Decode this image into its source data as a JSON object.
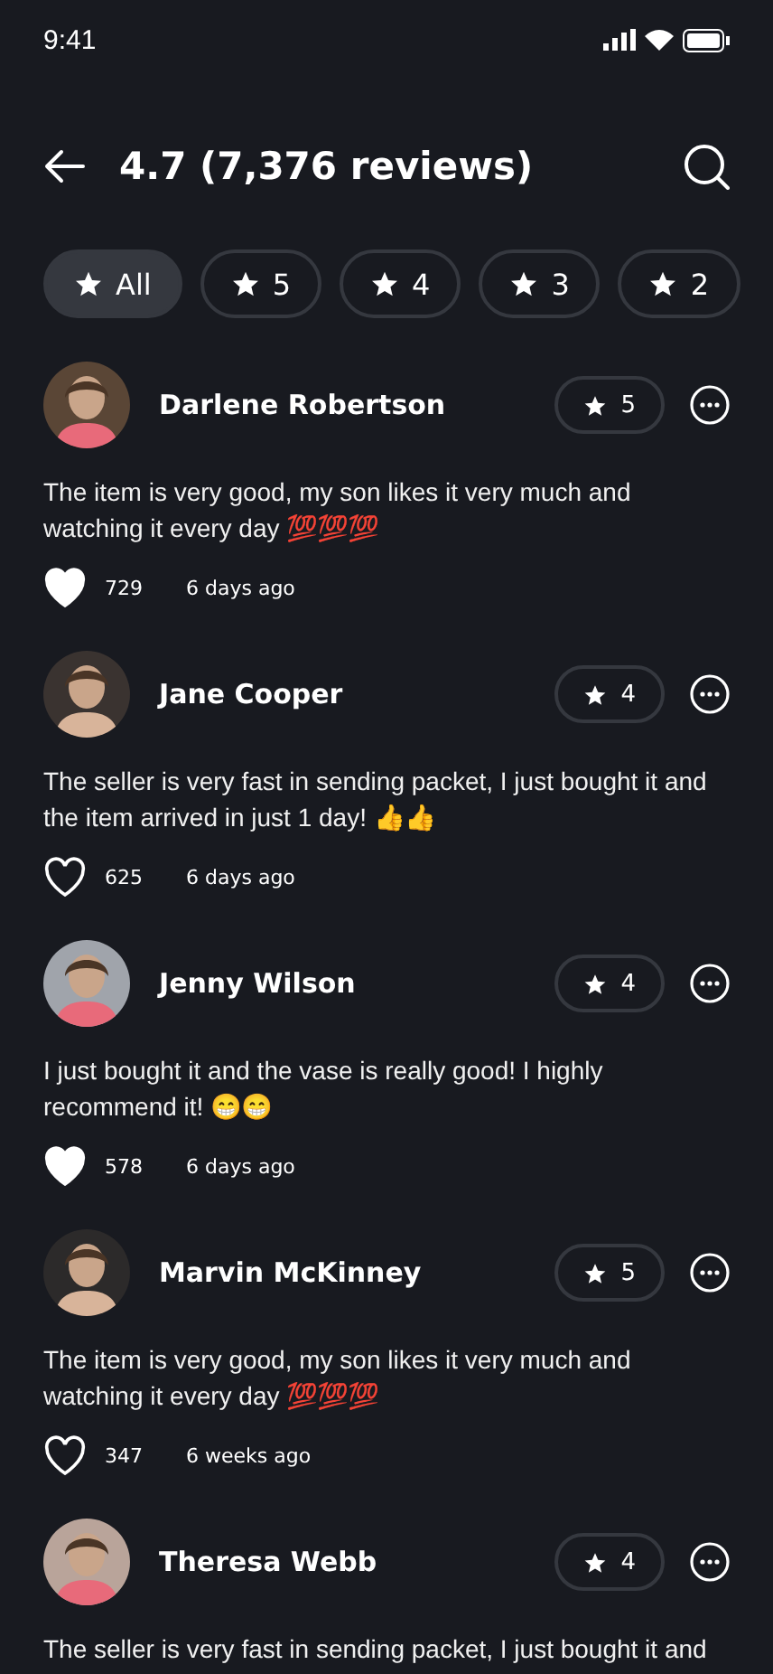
{
  "status_bar": {
    "time": "9:41"
  },
  "header": {
    "title": "4.7 (7,376 reviews)"
  },
  "filters": [
    {
      "label": "All",
      "selected": true
    },
    {
      "label": "5",
      "selected": false
    },
    {
      "label": "4",
      "selected": false
    },
    {
      "label": "3",
      "selected": false
    },
    {
      "label": "2",
      "selected": false
    }
  ],
  "reviews": [
    {
      "name": "Darlene Robertson",
      "rating": "5",
      "text": "The item is very good, my son likes it very much and watching it every day 💯💯💯",
      "liked": true,
      "likes": "729",
      "time": "6 days ago"
    },
    {
      "name": "Jane Cooper",
      "rating": "4",
      "text": "The seller is very fast in sending packet, I just bought it and the item arrived in just 1 day! 👍👍",
      "liked": false,
      "likes": "625",
      "time": "6 days ago"
    },
    {
      "name": "Jenny Wilson",
      "rating": "4",
      "text": "I just bought it and the vase is really good! I highly recommend it! 😁😁",
      "liked": true,
      "likes": "578",
      "time": "6 days ago"
    },
    {
      "name": "Marvin McKinney",
      "rating": "5",
      "text": "The item is very good, my son likes it very much and watching it every day 💯💯💯",
      "liked": false,
      "likes": "347",
      "time": "6 weeks ago"
    },
    {
      "name": "Theresa Webb",
      "rating": "4",
      "text": "The seller is very fast in sending packet, I just bought it and"
    }
  ]
}
